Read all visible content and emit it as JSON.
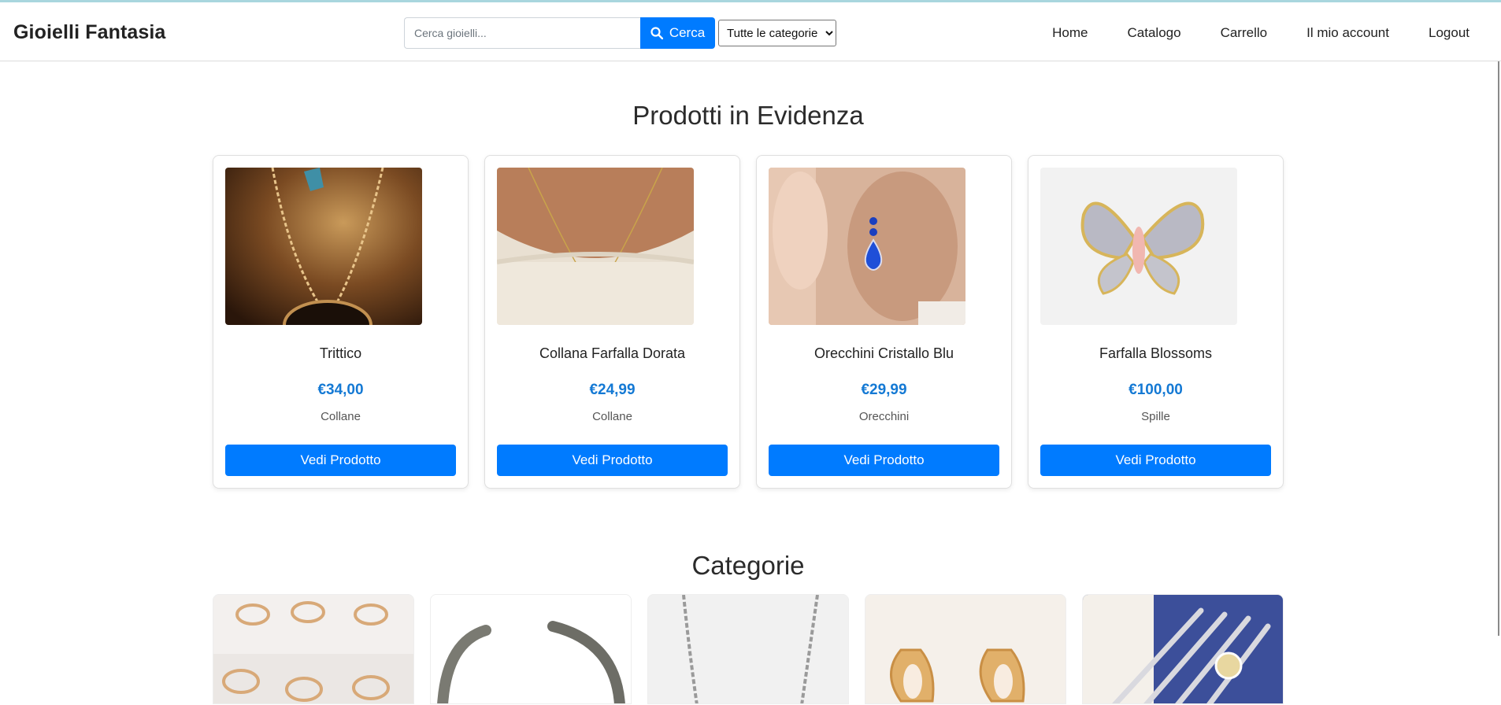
{
  "brand": "Gioielli Fantasia",
  "search": {
    "placeholder": "Cerca gioielli...",
    "button_label": "Cerca",
    "category_selected": "Tutte le categorie"
  },
  "nav": [
    "Home",
    "Catalogo",
    "Carrello",
    "Il mio account",
    "Logout"
  ],
  "featured": {
    "title": "Prodotti in Evidenza",
    "products": [
      {
        "name": "Trittico",
        "price": "€34,00",
        "category": "Collane",
        "button": "Vedi Prodotto"
      },
      {
        "name": "Collana Farfalla Dorata",
        "price": "€24,99",
        "category": "Collane",
        "button": "Vedi Prodotto"
      },
      {
        "name": "Orecchini Cristallo Blu",
        "price": "€29,99",
        "category": "Orecchini",
        "button": "Vedi Prodotto"
      },
      {
        "name": "Farfalla Blossoms",
        "price": "€100,00",
        "category": "Spille",
        "button": "Vedi Prodotto"
      }
    ]
  },
  "categories": {
    "title": "Categorie",
    "tiles": [
      "rings-image",
      "bracelet-image",
      "necklace-image",
      "earrings-image",
      "brooches-image"
    ]
  },
  "colors": {
    "accent": "#007bff",
    "price": "#1479d4"
  }
}
